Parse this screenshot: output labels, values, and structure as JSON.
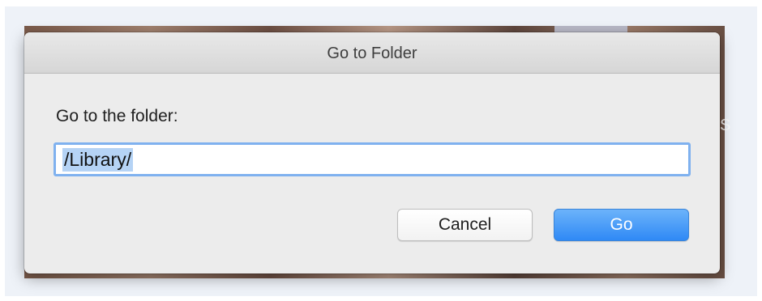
{
  "dialog": {
    "title": "Go to Folder",
    "prompt": "Go to the folder:",
    "path_value": "/Library/"
  },
  "buttons": {
    "cancel_label": "Cancel",
    "go_label": "Go"
  },
  "background": {
    "edge_glyph": "S"
  },
  "colors": {
    "accent": "#2f89f5",
    "focus_ring": "#7fb1ef",
    "selection": "#b5d3f5",
    "dialog_bg": "#ececec"
  }
}
